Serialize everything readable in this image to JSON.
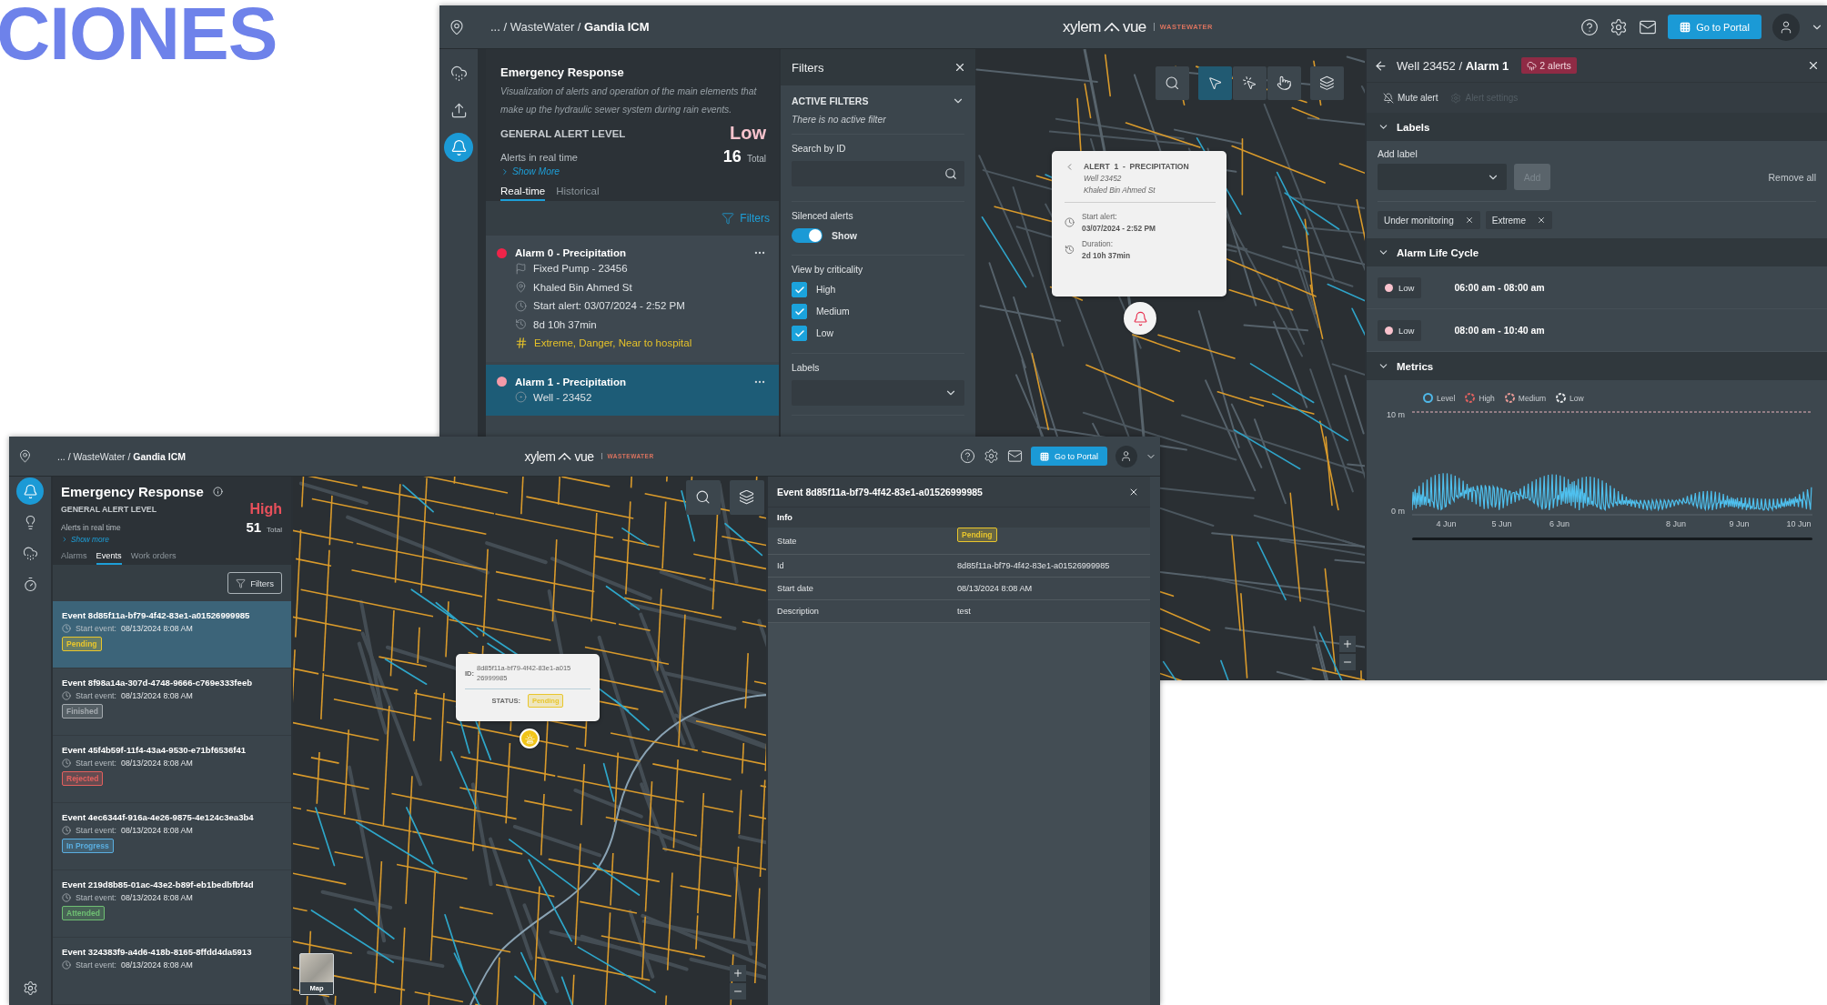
{
  "slide_heading": "CIONES",
  "back_window": {
    "header": {
      "breadcrumb": "... / WasteWater / **Gandia ICM**",
      "logo": {
        "brand": "xylem",
        "product": "vue",
        "division": "WASTEWATER"
      },
      "portal_button": "Go to Portal"
    },
    "rail": [
      {
        "kind": "rain",
        "selected": false
      },
      {
        "kind": "flood",
        "selected": false
      },
      {
        "kind": "bell",
        "selected": true
      }
    ],
    "overview": {
      "title": "Emergency Response",
      "description": "Visualization of alerts and operation of the main elements that make up the hydraulic sewer system during rain events.",
      "alert_level_label": "GENERAL ALERT LEVEL",
      "alert_level": {
        "text": "Low",
        "kind": "low"
      },
      "realtime_label": "Alerts in real time",
      "count": "16",
      "count_unit": "Total",
      "show_more": "Show More",
      "tabs": [
        {
          "label": "Real-time",
          "selected": true
        },
        {
          "label": "Historical",
          "selected": false
        }
      ],
      "filters_button": "Filters"
    },
    "alarms": [
      {
        "title": "Alarm 0 - Precipitation",
        "color": "#ef2449",
        "selected": false,
        "details": [
          {
            "kind": "asset",
            "text": "Fixed Pump - 23456"
          },
          {
            "kind": "address",
            "text": "Khaled Bin Ahmed St"
          },
          {
            "kind": "start",
            "text": "Start alert: 03/07/2024 - 2:52 PM"
          },
          {
            "kind": "duration",
            "text": "8d 10h 37min"
          }
        ],
        "tags": "Extreme, Danger, Near to hospital"
      },
      {
        "title": "Alarm 1 - Precipitation",
        "color": "#f49aa8",
        "selected": true,
        "details": [
          {
            "kind": "well",
            "text": "Well - 23452"
          }
        ]
      }
    ],
    "filters": {
      "title": "Filters",
      "active_filters": {
        "heading": "ACTIVE FILTERS",
        "expanded": true,
        "empty_text": "There is no active filter"
      },
      "search_label": "Search by ID",
      "silenced": {
        "label": "Silenced alerts",
        "on": true,
        "text": "Show"
      },
      "criticality": {
        "label": "View by criticality",
        "options": [
          {
            "label": "High",
            "checked": true
          },
          {
            "label": "Medium",
            "checked": true
          },
          {
            "label": "Low",
            "checked": true
          }
        ]
      },
      "labels_label": "Labels"
    },
    "map": {
      "toolbar": [
        {
          "kind": "search",
          "selected": false
        },
        {
          "kind": "select",
          "selected": true
        },
        {
          "kind": "select-add",
          "selected": false
        },
        {
          "kind": "select-remove",
          "selected": false
        },
        {
          "kind": "layers",
          "selected": false
        }
      ],
      "popup": {
        "title": "ALERT  1  -  PRECIPITATION",
        "subtitle": "Well 23452",
        "address": "Khaled Bin Ahmed St",
        "start_label": "Start alert:",
        "start_value": "03/07/2024 - 2:52 PM",
        "duration_label": "Duration:",
        "duration_value": "2d 10h 37min"
      }
    },
    "detail": {
      "title": "Well 23452 / **Alarm 1**",
      "alerts_badge": "2 alerts",
      "actions": [
        {
          "label": "Mute alert",
          "kind": "mute",
          "disabled": false
        },
        {
          "label": "Alert settings",
          "kind": "settings",
          "disabled": true
        }
      ],
      "labels_section": {
        "title": "Labels",
        "expanded": true,
        "add_label": "Add label",
        "add_button": "Add",
        "add_disabled": true,
        "remove_all": "Remove all",
        "tags": [
          "Under monitoring",
          "Extreme"
        ]
      },
      "lifecycle": {
        "title": "Alarm Life Cycle",
        "expanded": true,
        "rows": [
          {
            "level": "Low",
            "color": "#f9c2cd",
            "time": "06:00 am - 08:00 am"
          },
          {
            "level": "Low",
            "color": "#f9c2cd",
            "time": "08:00 am - 10:40 am"
          }
        ]
      },
      "metrics": {
        "title": "Metrics",
        "expanded": true,
        "legend": [
          {
            "label": "Level",
            "color": "#4fb8e8",
            "kind": "solid"
          },
          {
            "label": "High",
            "color": "#e0615f",
            "kind": "dashed"
          },
          {
            "label": "Medium",
            "color": "#e89a96",
            "kind": "dashed"
          },
          {
            "label": "Low",
            "color": "#e6e8ea",
            "kind": "dashed"
          }
        ],
        "y_labels": [
          "10 m",
          "0 m"
        ],
        "x_labels": [
          "4 Jun",
          "5 Jun",
          "6 Jun",
          "8 Jun",
          "9 Jun",
          "10 Jun"
        ]
      }
    }
  },
  "front_window": {
    "header": {
      "breadcrumb": "... / WasteWater / **Gandia ICM**",
      "logo": {
        "brand": "xylem",
        "product": "vue",
        "division": "WASTEWATER"
      },
      "portal_button": "Go to Portal"
    },
    "rail": [
      {
        "kind": "bell",
        "selected": true
      },
      {
        "kind": "bulb",
        "selected": false
      },
      {
        "kind": "rain",
        "selected": false
      },
      {
        "kind": "timer",
        "selected": false
      }
    ],
    "overview": {
      "title": "Emergency Response",
      "alert_level_label": "GENERAL ALERT LEVEL",
      "alert_level": {
        "text": "High",
        "kind": "high"
      },
      "realtime_label": "Alerts in real time",
      "count": "51",
      "count_unit": "Total",
      "show_more": "Show more",
      "tabs": [
        {
          "label": "Alarms",
          "selected": false
        },
        {
          "label": "Events",
          "selected": true
        },
        {
          "label": "Work orders",
          "selected": false
        }
      ],
      "filters_button": "Filters"
    },
    "events": [
      {
        "title": "Event 8d85f11a-bf79-4f42-83e1-a01526999985",
        "start_label": "Start event:",
        "start_value": "08/13/2024 8:08 AM",
        "status": {
          "label": "Pending",
          "color": "#e9c62c"
        },
        "selected": true
      },
      {
        "title": "Event 8f98a14a-307d-4748-9666-c769e333feeb",
        "start_label": "Start event:",
        "start_value": "08/13/2024 8:08 AM",
        "status": {
          "label": "Finished",
          "color": "#a5abb0"
        },
        "selected": false
      },
      {
        "title": "Event 45f4b59f-11f4-43a4-9530-e71bf6536f41",
        "start_label": "Start event:",
        "start_value": "08/13/2024 8:08 AM",
        "status": {
          "label": "Rejected",
          "color": "#e3605e"
        },
        "selected": false
      },
      {
        "title": "Event 4ec6344f-916a-4e26-9875-4e124c3ea3b4",
        "start_label": "Start event:",
        "start_value": "08/13/2024 8:08 AM",
        "status": {
          "label": "In Progress",
          "color": "#5aaee0"
        },
        "selected": false
      },
      {
        "title": "Event 219d8b85-01ac-43e2-b89f-eb1bedbfbf4d",
        "start_label": "Start event:",
        "start_value": "08/13/2024 8:08 AM",
        "status": {
          "label": "Attended",
          "color": "#6fbf73"
        },
        "selected": false
      },
      {
        "title": "Event 324383f9-a4d6-418b-8165-8ffdd4da5913",
        "start_label": "Start event:",
        "start_value": "08/13/2024 8:08 AM",
        "selected": false
      }
    ],
    "map": {
      "toolbar": [
        {
          "kind": "search",
          "selected": false
        },
        {
          "kind": "layers",
          "selected": false
        }
      ],
      "popup": {
        "id_label": "ID:",
        "id_value": "8d85f11a-bf79-4f42-83e1-a01526999985",
        "status_label": "STATUS:",
        "status": {
          "label": "Pending",
          "color": "#e9c62c"
        }
      },
      "thumbnail_label": "Map"
    },
    "detail": {
      "title": "Event 8d85f11a-bf79-4f42-83e1-a01526999985",
      "section": "Info",
      "rows": [
        {
          "label": "State",
          "kind": "badge",
          "value": "Pending",
          "color": "#e9c62c"
        },
        {
          "label": "Id",
          "kind": "text",
          "value": "8d85f11a-bf79-4f42-83e1-a01526999985"
        },
        {
          "label": "Start date",
          "kind": "text",
          "value": "08/13/2024 8:08 AM"
        },
        {
          "label": "Description",
          "kind": "text",
          "value": "test"
        }
      ]
    }
  }
}
